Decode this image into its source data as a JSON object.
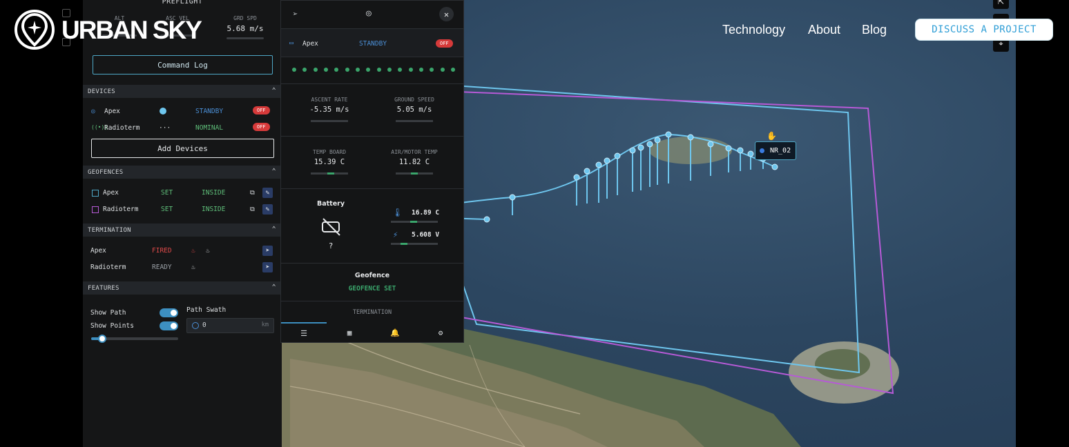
{
  "site": {
    "brand": "URBAN SKY",
    "nav": [
      "Technology",
      "About",
      "Blog"
    ],
    "cta": "DISCUSS A PROJECT"
  },
  "preflight": {
    "title": "PREFLIGHT",
    "stats": [
      {
        "label": "ALT",
        "value": ""
      },
      {
        "label": "ASC VEL",
        "value": ""
      },
      {
        "label": "GRD SPD",
        "value": "5.68 m/s"
      }
    ],
    "command_log": "Command Log"
  },
  "devices": {
    "heading": "DEVICES",
    "items": [
      {
        "name": "Apex",
        "status": "STANDBY",
        "power": "OFF"
      },
      {
        "name": "Radioterm",
        "status": "NOMINAL",
        "power": "OFF"
      }
    ],
    "add_label": "Add Devices"
  },
  "geofences": {
    "heading": "GEOFENCES",
    "items": [
      {
        "name": "Apex",
        "state": "SET",
        "position": "INSIDE"
      },
      {
        "name": "Radioterm",
        "state": "SET",
        "position": "INSIDE"
      }
    ]
  },
  "termination": {
    "heading": "TERMINATION",
    "items": [
      {
        "name": "Apex",
        "state": "FIRED"
      },
      {
        "name": "Radioterm",
        "state": "READY"
      }
    ]
  },
  "features": {
    "heading": "FEATURES",
    "show_path": "Show Path",
    "show_points": "Show Points",
    "path_swath_label": "Path Swath",
    "path_swath_value": "0",
    "path_swath_unit": "km"
  },
  "popup": {
    "device": "Apex",
    "status": "STANDBY",
    "power": "OFF",
    "ascent_rate": {
      "label": "ASCENT RATE",
      "value": "-5.35 m/s"
    },
    "ground_speed": {
      "label": "GROUND SPEED",
      "value": "5.05 m/s"
    },
    "temp_board": {
      "label": "TEMP BOARD",
      "value": "15.39 C"
    },
    "air_motor_temp": {
      "label": "AIR/MOTOR TEMP",
      "value": "11.82 C"
    },
    "battery": {
      "label": "Battery",
      "value": "?"
    },
    "battery_temp": "16.89 C",
    "battery_voltage": "5.608 V",
    "geofence": {
      "label": "Geofence",
      "value": "GEOFENCE SET"
    },
    "termination_label": "TERMINATION"
  },
  "map": {
    "node_label": "NR_02"
  },
  "colors": {
    "accent": "#4fa8c7",
    "path": "#6ec6ee",
    "geofence_purple": "#b65ad6",
    "off_red": "#d63a3a",
    "ok_green": "#3aa56b"
  }
}
